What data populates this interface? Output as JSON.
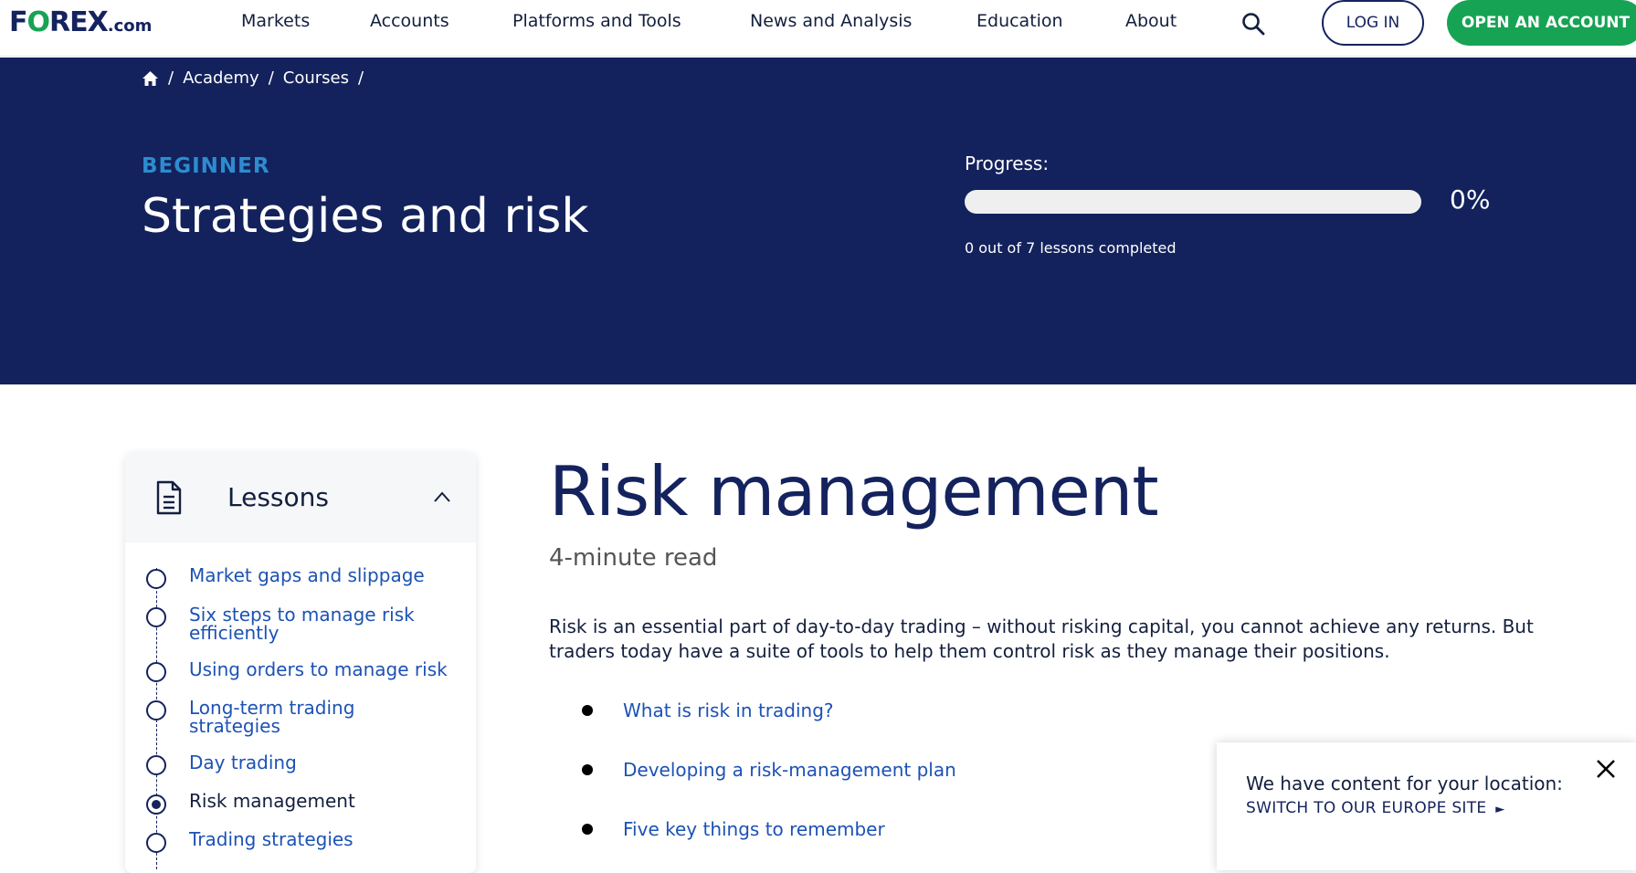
{
  "brand": {
    "logo_left": "F",
    "logo_o": "O",
    "logo_right": "REX",
    "logo_suffix": ".com",
    "accent_green": "#17a354",
    "navy": "#13225c"
  },
  "nav": {
    "items": [
      "Markets",
      "Accounts",
      "Platforms and Tools",
      "News and Analysis",
      "Education",
      "About"
    ],
    "search_icon": "search-icon",
    "login_label": "LOG IN",
    "open_account_label": "OPEN AN ACCOUNT"
  },
  "breadcrumb": {
    "home_icon": "home-icon",
    "items": [
      "Academy",
      "Courses"
    ],
    "separator": "/"
  },
  "course": {
    "level": "BEGINNER",
    "title": "Strategies and risk",
    "progress_label": "Progress:",
    "progress_value": 0,
    "progress_text": "0%",
    "lessons_completed_text": "0 out of 7 lessons completed"
  },
  "sidebar": {
    "title": "Lessons",
    "document_icon": "document-icon",
    "collapse_icon": "chevron-up-icon",
    "lessons": [
      {
        "line1": "Market gaps and slippage",
        "line2": "",
        "current": false
      },
      {
        "line1": "Six steps to manage risk",
        "line2": "efficiently",
        "current": false
      },
      {
        "line1": "Using orders to manage risk",
        "line2": "",
        "current": false
      },
      {
        "line1": "Long-term trading",
        "line2": "strategies",
        "current": false
      },
      {
        "line1": "Day trading",
        "line2": "",
        "current": false
      },
      {
        "line1": "Risk management",
        "line2": "",
        "current": true
      },
      {
        "line1": "Trading strategies",
        "line2": "",
        "current": false
      }
    ]
  },
  "article": {
    "title": "Risk management",
    "read_time": "4-minute read",
    "intro_line1": "Risk is an essential part of day-to-day trading – without risking capital, you cannot achieve any returns. But",
    "intro_line2": "traders today have a suite of tools to help them control risk as they manage their positions.",
    "toc": [
      "What is risk in trading?",
      "Developing a risk-management plan",
      "Five key things to remember"
    ]
  },
  "location_popup": {
    "message": "We have content for your location:",
    "link": "SWITCH TO OUR EUROPE SITE",
    "link_arrow": "►",
    "close_icon": "close-icon"
  }
}
